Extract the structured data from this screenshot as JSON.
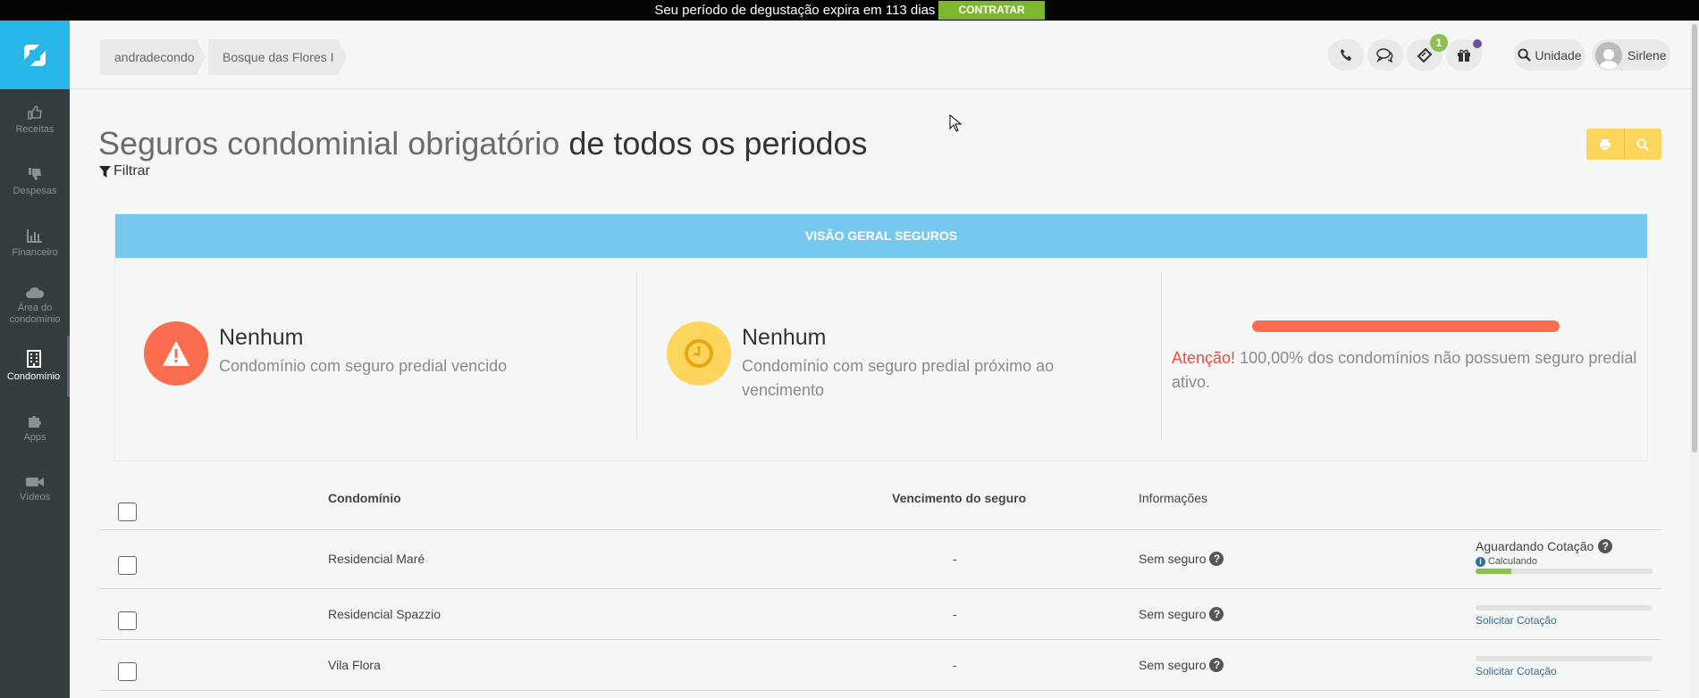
{
  "trial": {
    "message": "Seu período de degustação expira em 113 dias",
    "cta": "CONTRATAR"
  },
  "sidebar": {
    "items": [
      {
        "label": "Receitas",
        "icon": "thumbs-up-icon"
      },
      {
        "label": "Despesas",
        "icon": "thumbs-down-icon"
      },
      {
        "label": "Financeiro",
        "icon": "bar-chart-icon"
      },
      {
        "label": "Área do condomínio",
        "icon": "cloud-icon"
      },
      {
        "label": "Condomínio",
        "icon": "building-icon",
        "active": true
      },
      {
        "label": "Apps",
        "icon": "puzzle-icon"
      },
      {
        "label": "Vídeos",
        "icon": "video-camera-icon"
      }
    ]
  },
  "header": {
    "breadcrumb": [
      "andradecondo",
      "Bosque das Flores I"
    ],
    "notifications_count": "1",
    "unit_label": "Unidade",
    "user_name": "Sirlene"
  },
  "page": {
    "title_light": "Seguros condominial obrigatório",
    "title_dark": "de todos os periodos",
    "filter_label": "Filtrar"
  },
  "overview": {
    "heading": "VISÃO GERAL SEGUROS",
    "expired": {
      "value": "Nenhum",
      "description": "Condomínio com seguro predial vencido"
    },
    "expiring": {
      "value": "Nenhum",
      "description": "Condomínio com seguro predial próximo ao vencimento"
    },
    "attention_label": "Atenção!",
    "attention_text": "100,00% dos condomínios não possuem seguro predial ativo.",
    "uninsured_fraction": 1.0
  },
  "table": {
    "columns": [
      "Condomínio",
      "Vencimento do seguro",
      "Informações"
    ],
    "rows": [
      {
        "name": "Residencial Maré",
        "expiry": "-",
        "info": "Sem seguro",
        "status": "Aguardando Cotação",
        "note": "Calculando",
        "progress": 0.2
      },
      {
        "name": "Residencial Spazzio",
        "expiry": "-",
        "info": "Sem seguro",
        "action": "Solicitar Cotação",
        "progress": 0
      },
      {
        "name": "Vila Flora",
        "expiry": "-",
        "info": "Sem seguro",
        "action": "Solicitar Cotação",
        "progress": 0
      }
    ]
  },
  "colors": {
    "accent": "#27b6e8",
    "sidebar": "#343d3e",
    "panel_header": "#76c8ef",
    "danger": "#fc6d4f",
    "warning": "#fcd55d",
    "success": "#8cc152"
  }
}
